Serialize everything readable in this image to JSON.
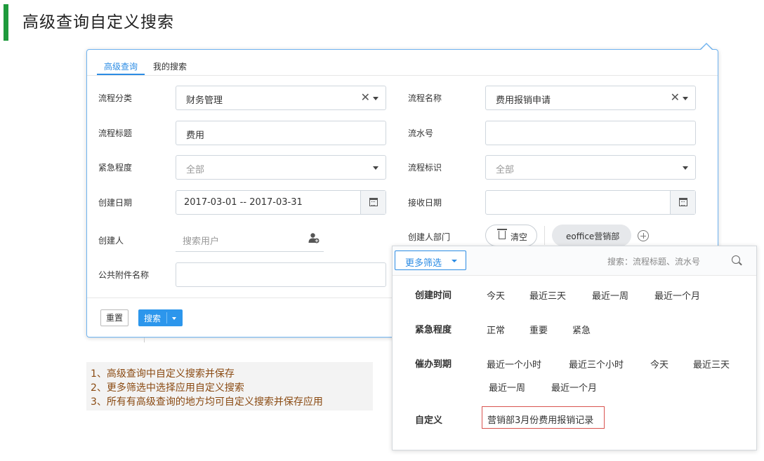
{
  "page_title": "高级查询自定义搜索",
  "tabs": [
    {
      "label": "高级查询",
      "active": true
    },
    {
      "label": "我的搜索",
      "active": false
    }
  ],
  "form": {
    "flow_category": {
      "label": "流程分类",
      "value": "财务管理"
    },
    "flow_name": {
      "label": "流程名称",
      "value": "费用报销申请"
    },
    "flow_title": {
      "label": "流程标题",
      "value": "费用"
    },
    "serial_no": {
      "label": "流水号",
      "value": ""
    },
    "urgency": {
      "label": "紧急程度",
      "value": "全部"
    },
    "flow_mark": {
      "label": "流程标识",
      "value": "全部"
    },
    "create_date": {
      "label": "创建日期",
      "value": "2017-03-01 -- 2017-03-31"
    },
    "receive_date": {
      "label": "接收日期",
      "value": ""
    },
    "creator": {
      "label": "创建人",
      "placeholder": "搜索用户"
    },
    "creator_dept": {
      "label": "创建人部门",
      "clear_label": "清空",
      "dept_tag": "eoffice营销部"
    },
    "attachment_name": {
      "label": "公共附件名称",
      "value": ""
    }
  },
  "buttons": {
    "reset": "重置",
    "search": "搜索"
  },
  "filter_panel": {
    "more_filter_label": "更多筛选",
    "search_hint": "搜索：流程标题、流水号",
    "rows": [
      {
        "label": "创建时间",
        "options": [
          "今天",
          "最近三天",
          "最近一周",
          "最近一个月"
        ]
      },
      {
        "label": "紧急程度",
        "options": [
          "正常",
          "重要",
          "紧急"
        ]
      },
      {
        "label": "催办到期",
        "options": [
          "最近一个小时",
          "最近三个小时",
          "今天",
          "最近三天",
          "最近一周",
          "最近一个月"
        ]
      },
      {
        "label": "自定义",
        "options": [
          "营销部3月份费用报销记录"
        ]
      }
    ]
  },
  "notes": [
    "1、高级查询中自定义搜索并保存",
    "2、更多筛选中选择应用自定义搜索",
    "3、所有有高级查询的地方均可自定义搜索并保存应用"
  ],
  "colors": {
    "accent_blue": "#2c8ce4",
    "title_bar_green": "#1e9a3c",
    "note_text": "#8a4a12",
    "highlight_border": "#d9534f"
  }
}
